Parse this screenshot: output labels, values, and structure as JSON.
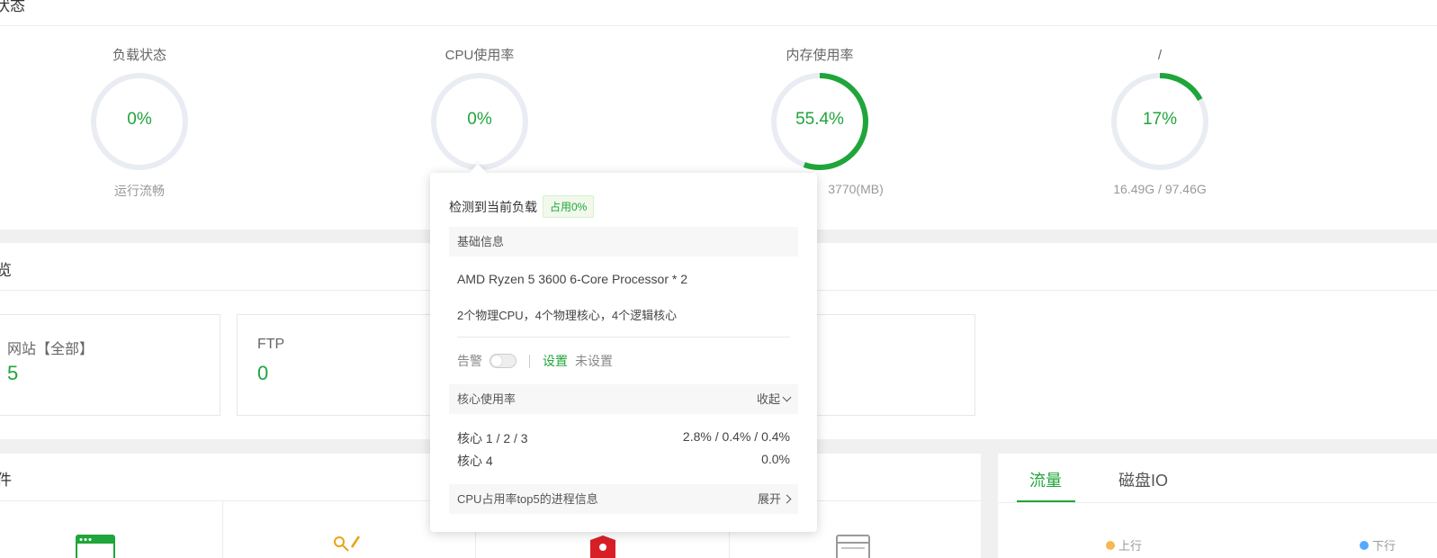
{
  "status": {
    "heading": "状态",
    "gauges": [
      {
        "title": "负载状态",
        "value": "0%",
        "sub": "运行流畅",
        "level": 0
      },
      {
        "title": "CPU使用率",
        "value": "0%",
        "sub": "",
        "level": 0
      },
      {
        "title": "内存使用率",
        "value": "55.4%",
        "sub": "3770(MB)",
        "level": 0.554
      },
      {
        "title": "/",
        "value": "17%",
        "sub": "16.49G / 97.46G",
        "level": 0.17
      }
    ],
    "colors": {
      "accent": "#20a53a",
      "track": "#e9ecf2"
    }
  },
  "overview": {
    "heading": "览",
    "cards": [
      {
        "label": "网站【全部】",
        "value": "5"
      },
      {
        "label": "FTP",
        "value": "0"
      }
    ]
  },
  "software": {
    "heading": "件"
  },
  "traffic": {
    "tabs": [
      {
        "label": "流量",
        "active": true
      },
      {
        "label": "磁盘IO",
        "active": false
      }
    ],
    "legend": [
      {
        "label": "上行",
        "color": "#f7b851"
      },
      {
        "label": "下行",
        "color": "#52a9ff"
      }
    ]
  },
  "cpu_popover": {
    "title": "检测到当前负载",
    "badge": "占用0%",
    "basic_info_label": "基础信息",
    "processor": "AMD Ryzen 5 3600 6-Core Processor * 2",
    "cores_desc": "2个物理CPU，4个物理核心，4个逻辑核心",
    "alarm_label": "告警",
    "alarm_set": "设置",
    "alarm_status": "未设置",
    "core_usage_label": "核心使用率",
    "collapse_label": "收起",
    "cores": [
      {
        "name": "核心 1 / 2 / 3",
        "value": "2.8% / 0.4% / 0.4%"
      },
      {
        "name": "核心 4",
        "value": "0.0%"
      }
    ],
    "top5_label": "CPU占用率top5的进程信息",
    "expand_label": "展开"
  }
}
